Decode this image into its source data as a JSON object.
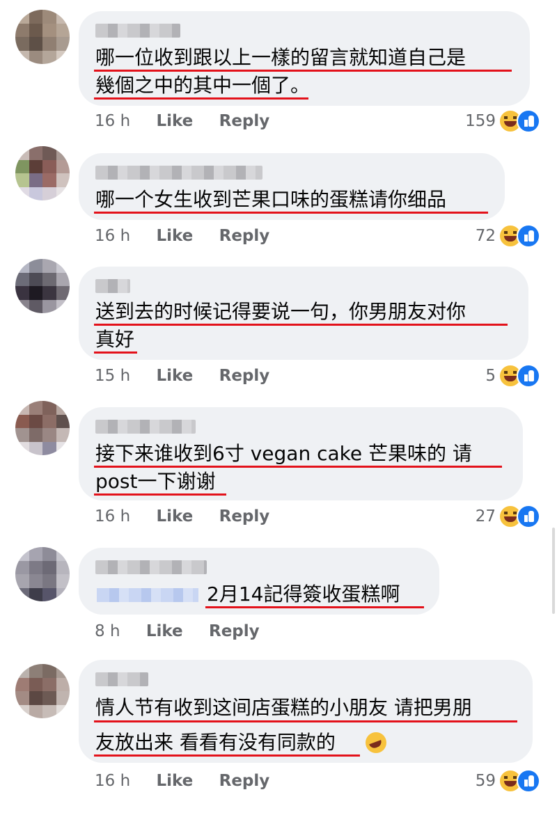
{
  "action_labels": {
    "like": "Like",
    "reply": "Reply"
  },
  "comments": [
    {
      "lines": [
        "哪一位收到跟以上一樣的留言就知道自己是",
        "幾個之中的其中一個了。"
      ],
      "time": "16 h",
      "reaction_count": "159"
    },
    {
      "lines": [
        "哪一个女生收到芒果口味的蛋糕请你细品"
      ],
      "time": "16 h",
      "reaction_count": "72"
    },
    {
      "lines": [
        "送到去的时候记得要说一句，你男朋友对你",
        "真好"
      ],
      "time": "15 h",
      "reaction_count": "5"
    },
    {
      "lines": [
        "接下来谁收到6寸 vegan cake 芒果味的 请",
        "post一下谢谢"
      ],
      "time": "16 h",
      "reaction_count": "27"
    },
    {
      "lines": [
        "2月14記得簽收蛋糕啊"
      ],
      "time": "8 h",
      "reaction_count": ""
    },
    {
      "lines": [
        "情人节有收到这间店蛋糕的小朋友 请把男朋",
        "友放出来 看看有没有同款的"
      ],
      "time": "16 h",
      "reaction_count": "59"
    }
  ],
  "colors": {
    "bubble": "#eff1f4",
    "underline": "#e3111a",
    "meta_text": "#65676b",
    "like_blue": "#1877f2",
    "haha_yellow": "#f7c23d"
  },
  "icons": [
    "avatar",
    "haha-reaction-icon",
    "like-reaction-icon",
    "rofl-emoji-icon"
  ]
}
